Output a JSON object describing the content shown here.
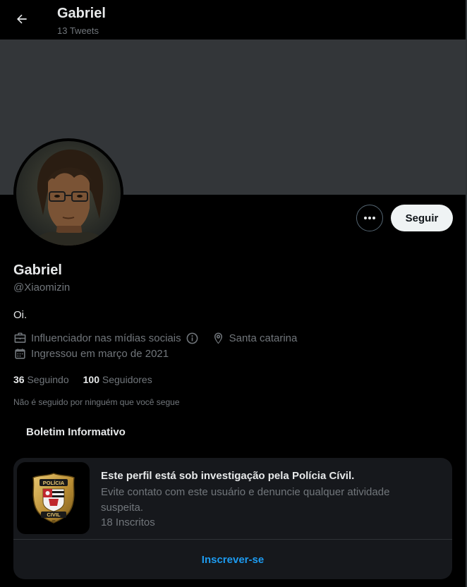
{
  "header": {
    "title": "Gabriel",
    "tweets": "13 Tweets"
  },
  "profile": {
    "name": "Gabriel",
    "handle": "@Xiaomizin",
    "bio": "Oi.",
    "category": "Influenciador nas mídias sociais",
    "location": "Santa catarina",
    "joined": "Ingressou em março de 2021",
    "following_count": "36",
    "following_label": "Seguindo",
    "followers_count": "100",
    "followers_label": "Seguidores",
    "not_followed": "Não é seguido por ninguém que você segue"
  },
  "actions": {
    "follow": "Seguir"
  },
  "newsletter": {
    "section_title": "Boletim Informativo",
    "headline": "Este perfil está sob investigação pela Polícia Cívil.",
    "description": "Evite contato com este usuário e denuncie qualquer atividade suspeita.",
    "subscribers": "18 Inscritos",
    "subscribe": "Inscrever-se",
    "badge_top": "POLÍCIA",
    "badge_bottom": "CIVIL",
    "badge_state": "SP"
  },
  "colors": {
    "background": "#000000",
    "banner": "#333639",
    "accent": "#1d9bf0",
    "muted": "#71767b"
  }
}
